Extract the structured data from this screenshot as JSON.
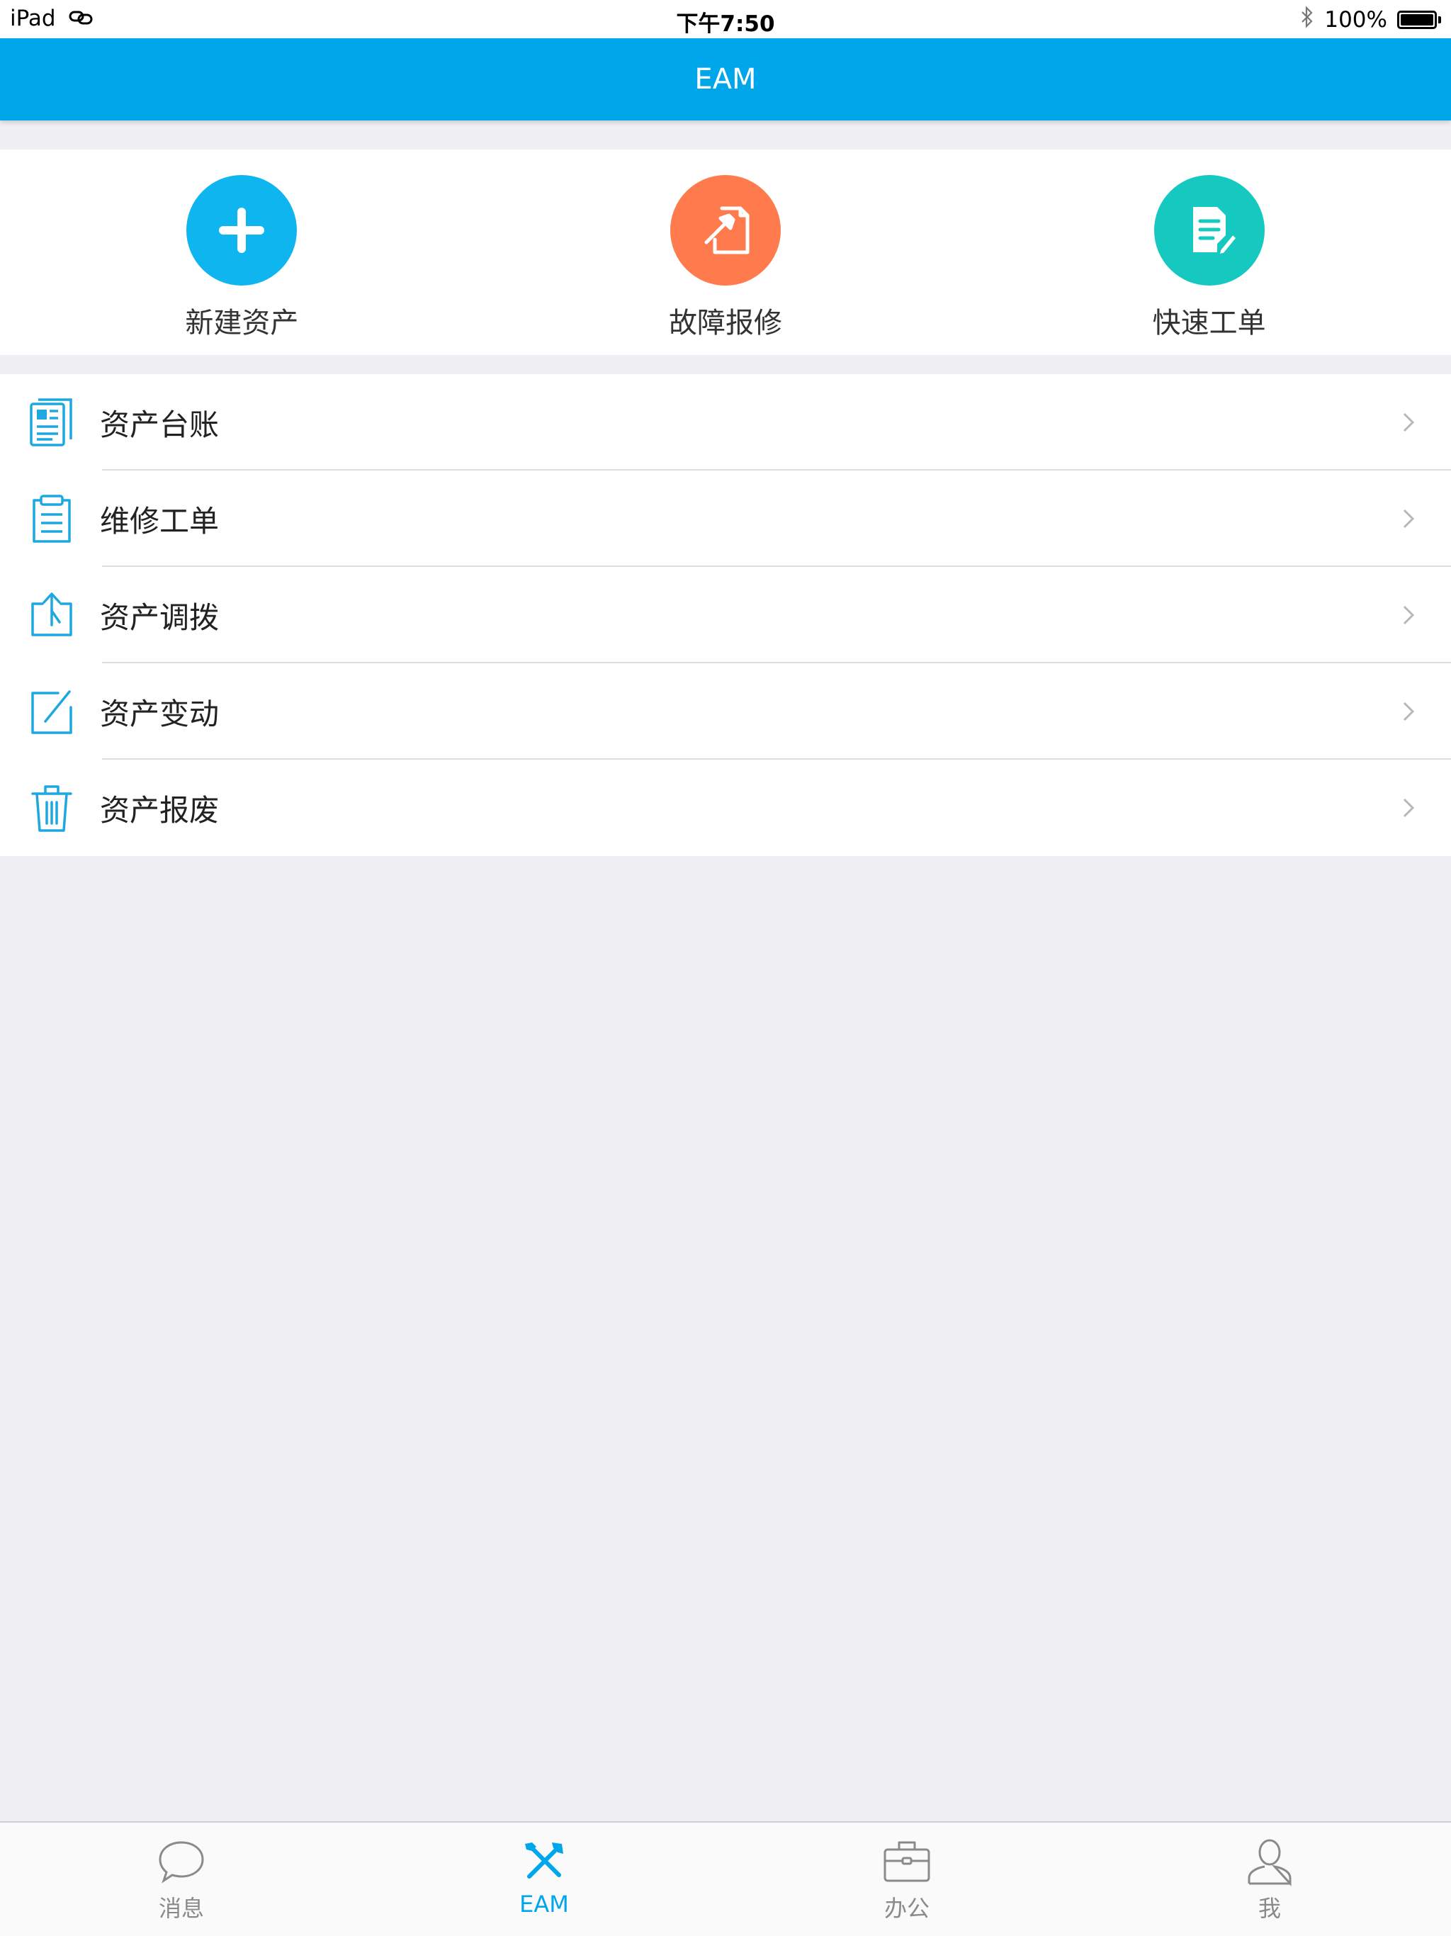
{
  "status_bar": {
    "device": "iPad",
    "time": "下午7:50",
    "battery_text": "100%"
  },
  "nav": {
    "title": "EAM"
  },
  "quick_actions": [
    {
      "label": "新建资产",
      "icon": "plus-icon",
      "color": "#0fb5ef"
    },
    {
      "label": "故障报修",
      "icon": "hammer-icon",
      "color": "#ff7a4d"
    },
    {
      "label": "快速工单",
      "icon": "document-edit-icon",
      "color": "#15c8c0"
    }
  ],
  "menu": [
    {
      "label": "资产台账",
      "icon": "ledger-icon"
    },
    {
      "label": "维修工单",
      "icon": "clipboard-icon"
    },
    {
      "label": "资产调拨",
      "icon": "transfer-icon"
    },
    {
      "label": "资产变动",
      "icon": "edit-square-icon"
    },
    {
      "label": "资产报废",
      "icon": "trash-icon"
    }
  ],
  "tabs": [
    {
      "label": "消息",
      "icon": "chat-bubble-icon",
      "active": false
    },
    {
      "label": "EAM",
      "icon": "tools-icon",
      "active": true
    },
    {
      "label": "办公",
      "icon": "briefcase-icon",
      "active": false
    },
    {
      "label": "我",
      "icon": "user-icon",
      "active": false
    }
  ],
  "colors": {
    "accent": "#00a6ea",
    "icon_blue": "#1da8e0",
    "background": "#efeff4",
    "tab_inactive": "#8a8a8a"
  }
}
